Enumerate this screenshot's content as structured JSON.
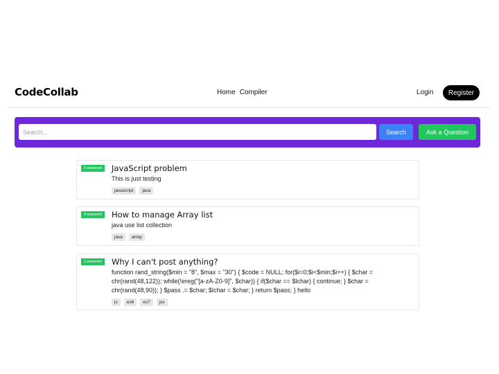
{
  "header": {
    "logo": "CodeCollab",
    "nav": [
      {
        "label": "Home"
      },
      {
        "label": "Compiler"
      }
    ],
    "login_label": "Login",
    "register_label": "Register"
  },
  "search": {
    "placeholder": "Search...",
    "search_label": "Search",
    "ask_label": "Ask a Question"
  },
  "questions": [
    {
      "status": "0 answered",
      "title": "JavaScript problem",
      "description": "This is just testing",
      "tags": [
        "javascript",
        "java"
      ]
    },
    {
      "status": "0 answered",
      "title": "How to manage Array list",
      "description": "java use list collection",
      "tags": [
        "java",
        "array"
      ]
    },
    {
      "status": "1 answered",
      "title": "Why I can't post anything?",
      "description": "function rand_string($min = \"8\", $max = \"30\") { $code = NULL; for($i=0;$i<$min;$i++) { $char = chr(rand(48,122)); while(!ereg(\"[a-zA-Z0-9]\", $char)) { if($char == $lchar) { continue; } $char = chr(rand(48,90)); } $pass .= $char; $lchar = $char; } return $pass; } hello",
      "tags": [
        "js",
        "es6",
        "es7",
        "jsx"
      ]
    }
  ],
  "colors": {
    "search_bar": "#6d28d9",
    "search_button": "#3b82f6",
    "ask_button": "#22c55e",
    "badge": "#22c55e",
    "register": "#000000"
  }
}
